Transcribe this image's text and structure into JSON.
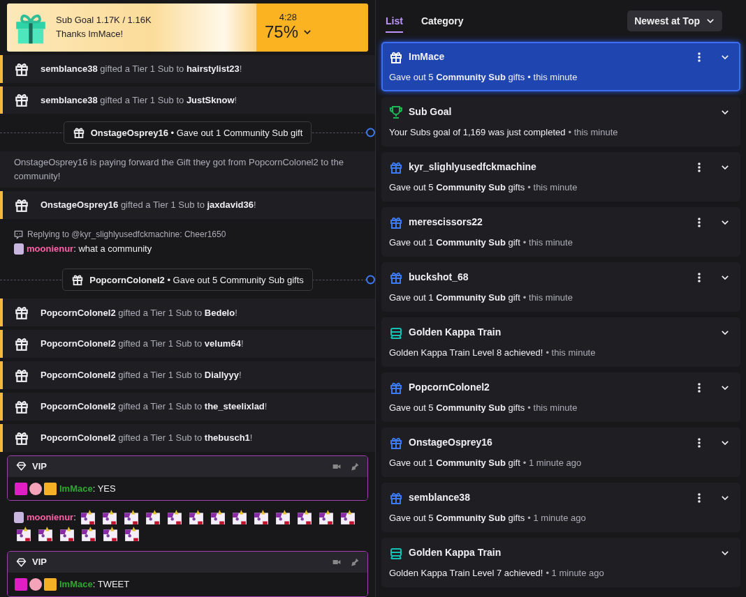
{
  "banner": {
    "title": "Sub Goal 1.17K / 1.16K",
    "subtitle": "Thanks ImMace!",
    "timer": "4:28",
    "percent": "75%"
  },
  "chat": [
    {
      "kind": "gift",
      "user": "semblance38",
      "text": "gifted a Tier 1 Sub to",
      "recipient": "hairstylist23",
      "end": "!"
    },
    {
      "kind": "gift",
      "user": "semblance38",
      "text": "gifted a Tier 1 Sub to",
      "recipient": "JustSknow",
      "end": "!"
    },
    {
      "kind": "divider",
      "user": "OnstageOsprey16",
      "text": "• Gave out 1 Community Sub gift"
    },
    {
      "kind": "notice",
      "text": "OnstageOsprey16 is paying forward the Gift they got from PopcornColonel2 to the community!"
    },
    {
      "kind": "gift",
      "user": "OnstageOsprey16",
      "text": "gifted a Tier 1 Sub to",
      "recipient": "jaxdavid36",
      "end": "!"
    },
    {
      "kind": "reply",
      "reply_to": "Replying to @kyr_slighlyusedfckmachine: Cheer1650",
      "user": "moonienur",
      "color": "#ff5fa8",
      "text": ": what a community"
    },
    {
      "kind": "divider",
      "user": "PopcornColonel2",
      "text": "• Gave out 5 Community Sub gifts"
    },
    {
      "kind": "gift",
      "user": "PopcornColonel2",
      "text": "gifted a Tier 1 Sub to",
      "recipient": "Bedelo",
      "end": "!"
    },
    {
      "kind": "gift",
      "user": "PopcornColonel2",
      "text": "gifted a Tier 1 Sub to",
      "recipient": "velum64",
      "end": "!"
    },
    {
      "kind": "gift",
      "user": "PopcornColonel2",
      "text": "gifted a Tier 1 Sub to",
      "recipient": "Diallyyy",
      "end": "!"
    },
    {
      "kind": "gift",
      "user": "PopcornColonel2",
      "text": "gifted a Tier 1 Sub to",
      "recipient": "the_steelixlad",
      "end": "!"
    },
    {
      "kind": "gift",
      "user": "PopcornColonel2",
      "text": "gifted a Tier 1 Sub to",
      "recipient": "thebusch1",
      "end": "!"
    },
    {
      "kind": "vip",
      "label": "VIP",
      "user": "ImMace",
      "color": "#2fa82f",
      "text": ": YES"
    },
    {
      "kind": "emotes",
      "user": "moonienur",
      "color": "#ff5fa8",
      "text": ":",
      "emotes": [
        {
          "kind": "unicorn"
        },
        {
          "kind": "unicorn"
        },
        {
          "kind": "unicorn"
        },
        {
          "kind": "unicorn"
        },
        {
          "kind": "unicorn"
        },
        {
          "kind": "unicorn"
        },
        {
          "kind": "unicorn"
        },
        {
          "kind": "unicorn"
        },
        {
          "kind": "unicorn"
        },
        {
          "kind": "unicorn"
        },
        {
          "kind": "unicorn"
        },
        {
          "kind": "unicorn"
        },
        {
          "kind": "unicorn"
        },
        {
          "kind": "unicorn"
        },
        {
          "kind": "unicorn"
        },
        {
          "kind": "unicorn"
        },
        {
          "kind": "unicorn"
        },
        {
          "kind": "unicorn"
        },
        {
          "kind": "unicorn"
        }
      ]
    },
    {
      "kind": "vip",
      "label": "VIP",
      "user": "ImMace",
      "color": "#2fa82f",
      "text": ": TWEET"
    }
  ],
  "tabs": [
    {
      "label": "List",
      "selected": true
    },
    {
      "label": "Category",
      "selected": false
    }
  ],
  "sort": "Newest at Top",
  "events": [
    {
      "kind": "gift",
      "title": "ImMace",
      "text": "Gave out 5 **Community Sub** gifts",
      "time": "• this minute",
      "selected": true,
      "menu": true
    },
    {
      "kind": "goal",
      "title": "Sub Goal",
      "text": "Your Subs goal of 1,169 was just completed",
      "time": "• this minute",
      "selected": false,
      "menu": false
    },
    {
      "kind": "gift",
      "title": "kyr_slighlyusedfckmachine",
      "text": "Gave out 5 **Community Sub** gifts",
      "time": "• this minute",
      "selected": false,
      "menu": true
    },
    {
      "kind": "gift",
      "title": "merescissors22",
      "text": "Gave out 1 **Community Sub** gift",
      "time": "• this minute",
      "selected": false,
      "menu": true
    },
    {
      "kind": "gift",
      "title": "buckshot_68",
      "text": "Gave out 1 **Community Sub** gift",
      "time": "• this minute",
      "selected": false,
      "menu": true
    },
    {
      "kind": "train",
      "title": "Golden Kappa Train",
      "text": "Golden Kappa Train Level 8 achieved!",
      "time": "• this minute",
      "selected": false,
      "menu": false
    },
    {
      "kind": "gift",
      "title": "PopcornColonel2",
      "text": "Gave out 5 **Community Sub** gifts",
      "time": "• this minute",
      "selected": false,
      "menu": true
    },
    {
      "kind": "gift",
      "title": "OnstageOsprey16",
      "text": "Gave out 1 **Community Sub** gift",
      "time": "• 1 minute ago",
      "selected": false,
      "menu": true
    },
    {
      "kind": "gift",
      "title": "semblance38",
      "text": "Gave out 5 **Community Sub** gifts",
      "time": "• 1 minute ago",
      "selected": false,
      "menu": true
    },
    {
      "kind": "train",
      "title": "Golden Kappa Train",
      "text": "Golden Kappa Train Level 7 achieved!",
      "time": "• 1 minute ago",
      "selected": false,
      "menu": false
    }
  ]
}
